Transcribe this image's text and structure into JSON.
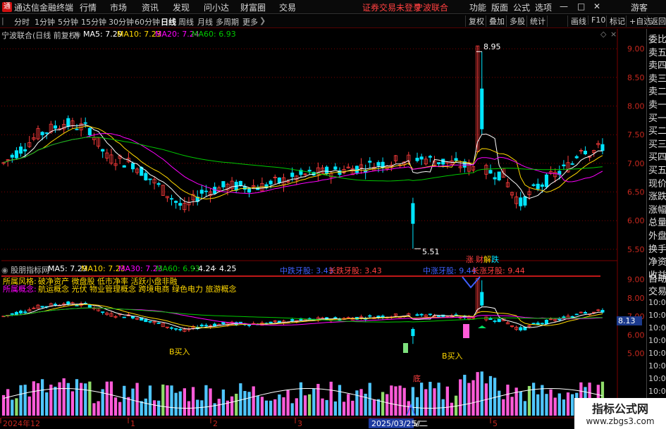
{
  "colors": {
    "up": "#ff3c3c",
    "down": "#00e5ff",
    "ma5": "#ffffff",
    "ma10": "#ffd800",
    "ma20": "#ff00ff",
    "ma60": "#00c800",
    "grid": "#7a0000",
    "accent": "#ff4444"
  },
  "menubar": {
    "app": "通达信金融终端",
    "items": [
      "行情",
      "市场",
      "资讯",
      "发现",
      "问小达",
      "财富圈",
      "交易"
    ],
    "notice": "证券交易未登录",
    "stock": "宁波联合",
    "right": [
      "功能",
      "版面",
      "公式",
      "选项"
    ],
    "guest": "游客",
    "logo_icon": "tdx-logo-icon"
  },
  "toolbar": {
    "periods": [
      "分时",
      "1分钟",
      "5分钟",
      "15分钟",
      "30分钟",
      "60分钟",
      "日线",
      "周线",
      "月线",
      "多周期",
      "更多"
    ],
    "active": "日线",
    "right": [
      "复权",
      "叠加",
      "多股",
      "统计",
      "画线",
      "F10",
      "标记",
      "+自选",
      "返回"
    ]
  },
  "main": {
    "title": "宁波联合(日线 前复权)",
    "ma": [
      {
        "name": "MA5",
        "value": "7.29",
        "color": "#ffffff"
      },
      {
        "name": "MA10",
        "value": "7.23",
        "color": "#ffd800"
      },
      {
        "name": "MA20",
        "value": "7.24",
        "color": "#ff00ff"
      },
      {
        "name": "MA60",
        "value": "6.93",
        "color": "#00c800"
      }
    ],
    "yticks": [
      "9.00",
      "8.50",
      "8.00",
      "7.50",
      "7.00",
      "6.50",
      "6.00",
      "5.50"
    ],
    "ymin": 5.4,
    "ymax": 9.15,
    "high_label": "8.95",
    "low_label": "5.51",
    "tag_up": "涨",
    "tag_cai": "财",
    "tag_jiao": "解",
    "tag_down": "跌"
  },
  "sub": {
    "title": "股朋指标网",
    "params": [
      {
        "name": "MA5",
        "value": "7.29",
        "color": "#ffffff"
      },
      {
        "name": "MA10",
        "value": "7.23",
        "color": "#ffd800"
      },
      {
        "name": "MA30",
        "value": "7.23",
        "color": "#ff00ff"
      },
      {
        "name": "MA60",
        "value": "6.93",
        "color": "#00c800"
      },
      {
        "name": "",
        "value": "4.24",
        "color": "#ffffff"
      },
      {
        "name": "",
        "value": "4.25",
        "color": "#ffffff"
      }
    ],
    "style_label": "所属风格:",
    "style_value": "破净资产 微盘股 低市净率 活跃小盘非融",
    "concept_label": "所属概念:",
    "concept_value": "航运概念 光伏 物业管理概念 跨境电商 绿色电力 旅游概念",
    "mid1": "中跌牙股: 3.43",
    "long1": "长跌牙股: 3.43",
    "mid2": "中涨牙股: 9.44",
    "long2": "长涨牙股: 9.44",
    "yticks": [
      "9.00",
      "8.00",
      "7.00",
      "6.00",
      "5.00"
    ],
    "price_tag": "8.13",
    "buy1": "B买入",
    "buy2": "B买入",
    "bottom": "底",
    "ymin": 4.3,
    "ymax": 9.4
  },
  "xaxis": {
    "labels": [
      "2024年12",
      "1",
      "2",
      "3",
      "2025/03/25/二",
      "5"
    ],
    "positions": [
      0,
      181,
      298,
      418,
      525,
      695
    ]
  },
  "side": [
    "委比",
    "卖五",
    "卖四",
    "卖三",
    "卖二",
    "卖一",
    "买一",
    "买二",
    "买三",
    "买四",
    "买五",
    "现价",
    "涨跌",
    "涨幅",
    "总量",
    "外盘",
    "换手",
    "净资",
    "收益"
  ],
  "side2": [
    "自动",
    "交易"
  ],
  "times": [
    "10:00",
    "10:00",
    "10:00",
    "10:01",
    "10:01",
    "10:01",
    "10:01",
    "10:01"
  ],
  "watermark": {
    "line1": "指标公式网",
    "line2": "www.zbgs3.com"
  }
}
